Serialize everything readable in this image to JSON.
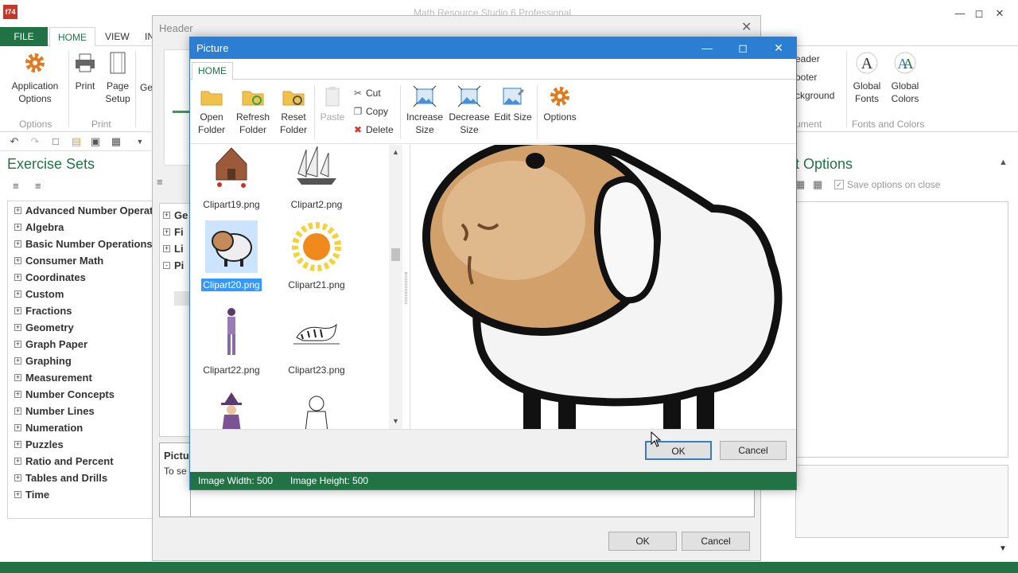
{
  "app": {
    "logo": "f74",
    "title": "Math Resource Studio 6 Professional",
    "tabs": [
      "FILE",
      "HOME",
      "VIEW",
      "IN"
    ]
  },
  "ribbon": {
    "left_buttons": [
      {
        "label1": "Application",
        "label2": "Options"
      },
      {
        "label1": "Print",
        "label2": ""
      },
      {
        "label1": "Page",
        "label2": "Setup"
      },
      {
        "label1": "Ge",
        "label2": ""
      }
    ],
    "groups": [
      "Options",
      "Print"
    ],
    "right_items": [
      "eader",
      "ooter",
      "ckground"
    ],
    "right_group": "ument",
    "fonts_buttons": [
      {
        "label1": "Global",
        "label2": "Fonts"
      },
      {
        "label1": "Global",
        "label2": "Colors"
      }
    ],
    "fonts_group": "Fonts and Colors"
  },
  "exercise_sets": {
    "title": "Exercise Sets",
    "items": [
      "Advanced Number Operat",
      "Algebra",
      "Basic Number Operations",
      "Consumer Math",
      "Coordinates",
      "Custom",
      "Fractions",
      "Geometry",
      "Graph Paper",
      "Graphing",
      "Measurement",
      "Number Concepts",
      "Number Lines",
      "Numeration",
      "Puzzles",
      "Ratio and Percent",
      "Tables and Drills",
      "Time"
    ]
  },
  "options_panel": {
    "title": "t Options",
    "save_checkbox": "Save options on close"
  },
  "header_dialog": {
    "title": "Header",
    "tree_items": [
      "Ge",
      "Fi",
      "Li",
      "Pi"
    ],
    "picture_label": "Pictu",
    "picture_text": "To se",
    "ok": "OK",
    "cancel": "Cancel"
  },
  "picture_dialog": {
    "title": "Picture",
    "tab": "HOME",
    "toolbar": {
      "open_folder": [
        "Open",
        "Folder"
      ],
      "refresh_folder": [
        "Refresh",
        "Folder"
      ],
      "reset_folder": [
        "Reset",
        "Folder"
      ],
      "paste": "Paste",
      "cut": "Cut",
      "copy": "Copy",
      "delete": "Delete",
      "increase_size": [
        "Increase",
        "Size"
      ],
      "decrease_size": [
        "Decrease",
        "Size"
      ],
      "edit_size": "Edit Size",
      "options": "Options"
    },
    "files": [
      "Clipart19.png",
      "Clipart2.png",
      "Clipart20.png",
      "Clipart21.png",
      "Clipart22.png",
      "Clipart23.png"
    ],
    "selected_file": "Clipart20.png",
    "ok": "OK",
    "cancel": "Cancel",
    "status": {
      "width": "Image Width: 500",
      "height": "Image Height: 500"
    }
  },
  "colors": {
    "accent_green": "#217346",
    "title_blue": "#2b7ed1",
    "selection_blue": "#3399ff"
  }
}
